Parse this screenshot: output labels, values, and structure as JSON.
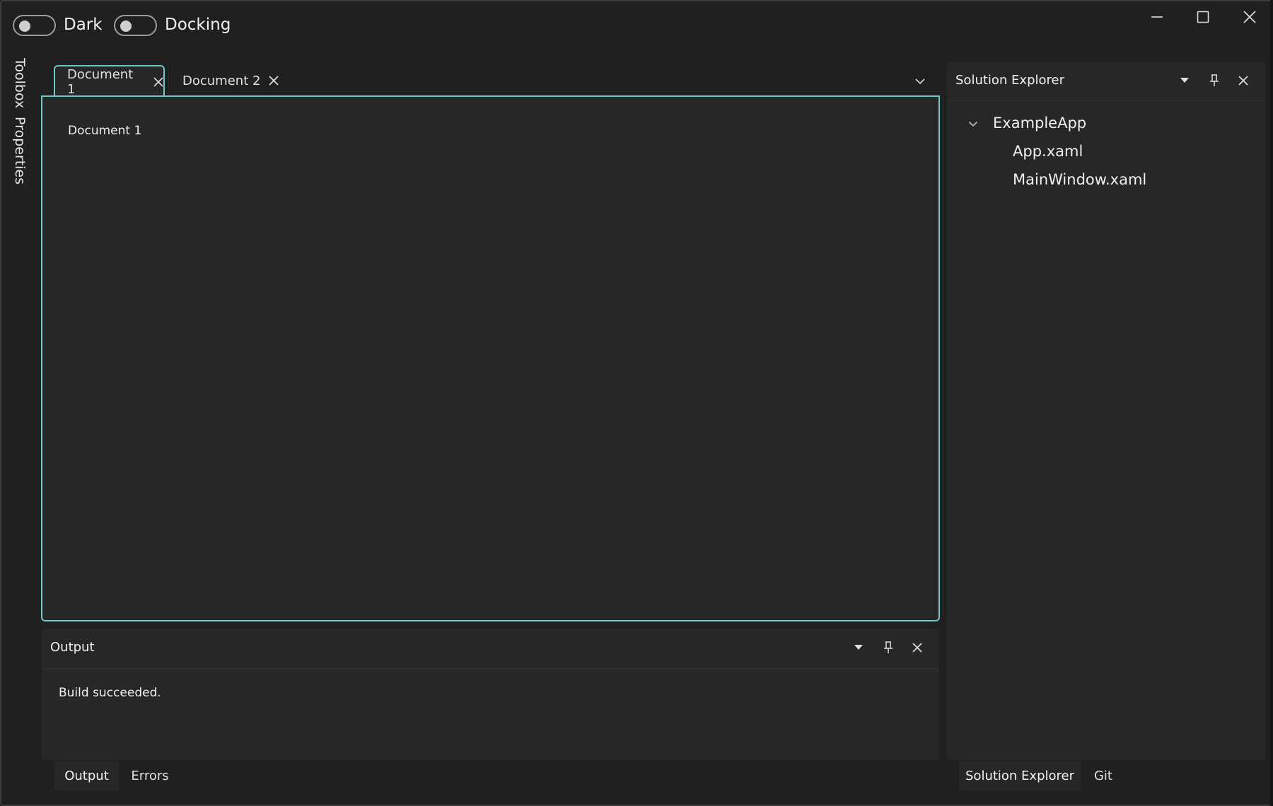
{
  "window": {
    "toggles": [
      {
        "label": "Dark",
        "on": false
      },
      {
        "label": "Docking",
        "on": false
      }
    ],
    "caption_buttons": [
      "minimize-icon",
      "maximize-icon",
      "close-icon"
    ]
  },
  "left_strip": {
    "tabs": [
      "Toolbox",
      "Properties"
    ]
  },
  "documents": {
    "tabs": [
      {
        "label": "Document 1",
        "active": true
      },
      {
        "label": "Document 2",
        "active": false
      }
    ],
    "content": "Document 1",
    "overflow_icon": "chevron-down-icon"
  },
  "output_panel": {
    "title": "Output",
    "content": "Build succeeded.",
    "tabs": [
      {
        "label": "Output",
        "active": true
      },
      {
        "label": "Errors",
        "active": false
      }
    ]
  },
  "solution_panel": {
    "title": "Solution Explorer",
    "tree": {
      "root": "ExampleApp",
      "children": [
        "App.xaml",
        "MainWindow.xaml"
      ]
    },
    "tabs": [
      {
        "label": "Solution Explorer",
        "active": true
      },
      {
        "label": "Git",
        "active": false
      }
    ]
  },
  "colors": {
    "accent": "#6fc8cc",
    "background": "#202020",
    "panel": "#272727"
  }
}
